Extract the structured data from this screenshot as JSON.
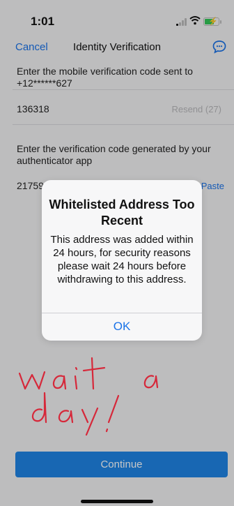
{
  "status_bar": {
    "time": "1:01"
  },
  "nav": {
    "cancel_label": "Cancel",
    "title": "Identity Verification"
  },
  "sms_section": {
    "label": "Enter the mobile verification code sent to +12******627",
    "code_value": "136318",
    "resend_label": "Resend (27)"
  },
  "auth_section": {
    "label": "Enter the verification code generated by your authenticator app",
    "code_value": "21759",
    "paste_label": "Paste"
  },
  "alert": {
    "title": "Whitelisted Address Too Recent",
    "message": "This address was added within 24 hours, for security reasons please wait 24 hours before withdrawing to this address.",
    "ok_label": "OK"
  },
  "handwritten_note": "wait a day!",
  "continue_label": "Continue",
  "colors": {
    "accent": "#1a73e8",
    "button": "#1f84e6",
    "annotation": "#d6283a",
    "battery": "#34c759"
  }
}
